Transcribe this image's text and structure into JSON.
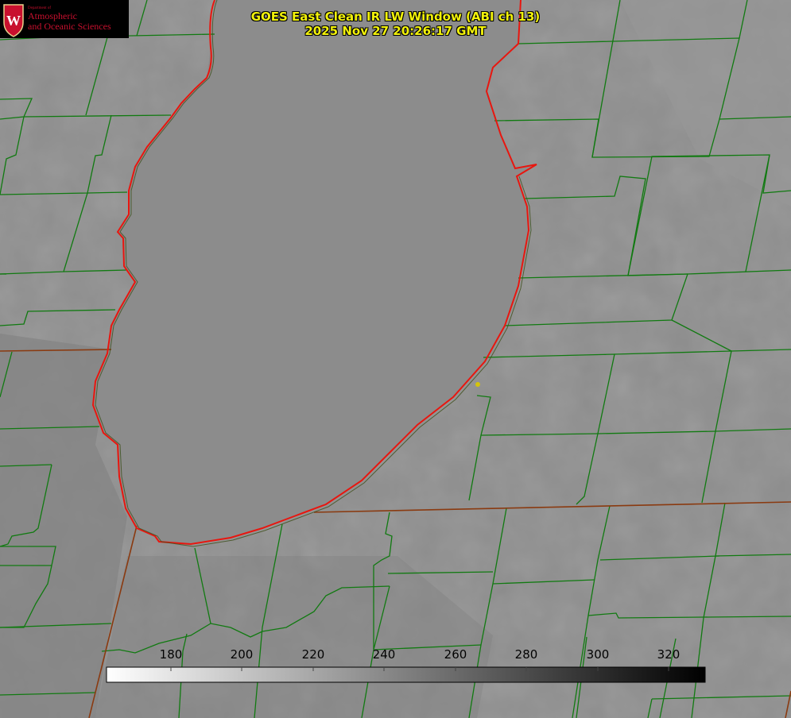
{
  "title": {
    "line1": "GOES East Clean IR LW Window (ABI ch 13)",
    "line2": "2025 Nov 27 20:26:17 GMT"
  },
  "logo": {
    "department": "Department of",
    "line1": "Atmospheric",
    "line2": "and Oceanic Sciences",
    "shield_letter": "W"
  },
  "colorbar": {
    "ticks": [
      "180",
      "200",
      "220",
      "240",
      "260",
      "280",
      "300",
      "320"
    ],
    "colormap": "white-to-black (gray)"
  },
  "map": {
    "region": "Lake Michigan",
    "lake_outline_color": "#e8160f",
    "county_line_color": "#117a11",
    "state_line_color": "#8a3a10",
    "marker_color": "#d4c40a"
  }
}
